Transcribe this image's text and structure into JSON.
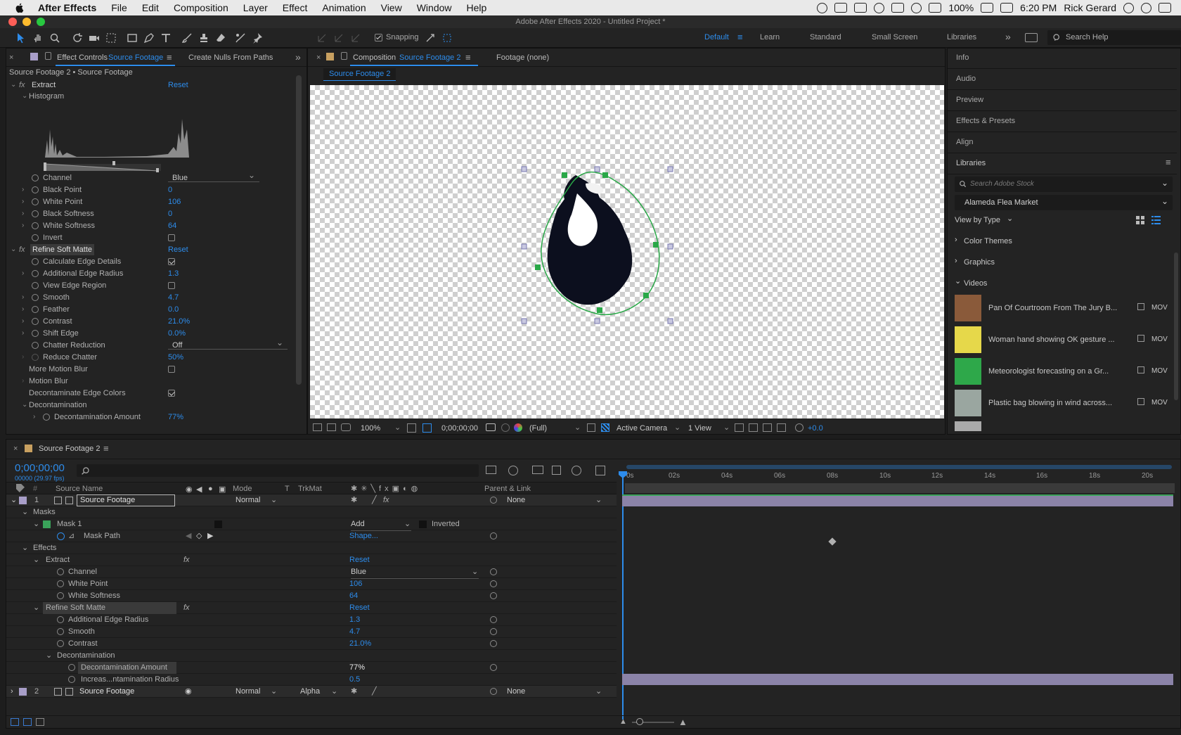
{
  "menubar": {
    "items": [
      "After Effects",
      "File",
      "Edit",
      "Composition",
      "Layer",
      "Effect",
      "Animation",
      "View",
      "Window",
      "Help"
    ],
    "battery": "100%",
    "time": "6:20 PM",
    "user": "Rick Gerard"
  },
  "titlebar": {
    "title": "Adobe After Effects 2020 - Untitled Project *"
  },
  "toolbar": {
    "snapping": "Snapping",
    "workspaces": [
      "Default",
      "Learn",
      "Standard",
      "Small Screen",
      "Libraries"
    ],
    "search_placeholder": "Search Help"
  },
  "effect_controls": {
    "tab_prefix": "Effect Controls",
    "tab_layer": "Source Footage",
    "tab2": "Create Nulls From Paths",
    "breadcrumb": "Source Footage 2 • Source Footage",
    "reset": "Reset",
    "extract": {
      "name": "Extract",
      "histogram": "Histogram",
      "channel": {
        "label": "Channel",
        "value": "Blue"
      },
      "black_point": {
        "label": "Black Point",
        "value": "0"
      },
      "white_point": {
        "label": "White Point",
        "value": "106"
      },
      "black_softness": {
        "label": "Black Softness",
        "value": "0"
      },
      "white_softness": {
        "label": "White Softness",
        "value": "64"
      },
      "invert": {
        "label": "Invert"
      }
    },
    "refine": {
      "name": "Refine Soft Matte",
      "calc_edge": {
        "label": "Calculate Edge Details"
      },
      "add_edge_radius": {
        "label": "Additional Edge Radius",
        "value": "1.3"
      },
      "view_edge": {
        "label": "View Edge Region"
      },
      "smooth": {
        "label": "Smooth",
        "value": "4.7"
      },
      "feather": {
        "label": "Feather",
        "value": "0.0"
      },
      "contrast": {
        "label": "Contrast",
        "value": "21.0%"
      },
      "shift_edge": {
        "label": "Shift Edge",
        "value": "0.0%"
      },
      "chatter": {
        "label": "Chatter Reduction",
        "value": "Off"
      },
      "reduce_chatter": {
        "label": "Reduce Chatter",
        "value": "50%"
      },
      "more_motion_blur": {
        "label": "More Motion Blur"
      },
      "motion_blur": {
        "label": "Motion Blur"
      },
      "decontam_colors": {
        "label": "Decontaminate Edge Colors"
      },
      "decontamination": {
        "label": "Decontamination"
      },
      "decontam_amount": {
        "label": "Decontamination Amount",
        "value": "77%"
      }
    }
  },
  "composition": {
    "tab_prefix": "Composition",
    "tab_comp": "Source Footage 2",
    "tab2": "Footage (none)",
    "flowchart_tab": "Source Footage 2",
    "zoom": "100%",
    "timecode": "0;00;00;00",
    "resolution": "(Full)",
    "camera": "Active Camera",
    "views": "1 View",
    "exposure": "+0.0"
  },
  "right_panel": {
    "items": [
      "Info",
      "Audio",
      "Preview",
      "Effects & Presets",
      "Align"
    ],
    "libraries": {
      "title": "Libraries",
      "search_placeholder": "Search Adobe Stock",
      "library": "Alameda Flea Market",
      "view_by": "View by Type",
      "groups": [
        "Color Themes",
        "Graphics",
        "Videos"
      ],
      "videos": [
        {
          "title": "Pan Of Courtroom From The Jury B...",
          "format": "MOV",
          "color": "#8a5a3a"
        },
        {
          "title": "Woman hand showing OK gesture ...",
          "format": "MOV",
          "color": "#e6d84a"
        },
        {
          "title": "Meteorologist forecasting on a Gr...",
          "format": "MOV",
          "color": "#2ea84a"
        },
        {
          "title": "Plastic bag blowing in wind across...",
          "format": "MOV",
          "color": "#9aa6a0"
        }
      ]
    }
  },
  "timeline": {
    "tab": "Source Footage 2",
    "timecode": "0;00;00;00",
    "fps": "00000 (29.97 fps)",
    "columns": {
      "source_name": "Source Name",
      "mode": "Mode",
      "t": "T",
      "trkmat": "TrkMat",
      "parent": "Parent & Link"
    },
    "ruler": [
      "0s",
      "02s",
      "04s",
      "06s",
      "08s",
      "10s",
      "12s",
      "14s",
      "16s",
      "18s",
      "20s"
    ],
    "layer1": {
      "num": "1",
      "name": "Source Footage",
      "mode": "Normal",
      "parent": "None"
    },
    "masks": "Masks",
    "mask1": {
      "name": "Mask 1",
      "mode": "Add",
      "inverted": "Inverted"
    },
    "mask_path": {
      "name": "Mask Path",
      "value": "Shape..."
    },
    "effects": "Effects",
    "extract": {
      "name": "Extract",
      "reset": "Reset"
    },
    "channel": {
      "name": "Channel",
      "value": "Blue"
    },
    "white_point": {
      "name": "White Point",
      "value": "106"
    },
    "white_softness": {
      "name": "White Softness",
      "value": "64"
    },
    "refine": {
      "name": "Refine Soft Matte",
      "reset": "Reset"
    },
    "add_edge_radius": {
      "name": "Additional Edge Radius",
      "value": "1.3"
    },
    "smooth": {
      "name": "Smooth",
      "value": "4.7"
    },
    "contrast": {
      "name": "Contrast",
      "value": "21.0%"
    },
    "decontamination": {
      "name": "Decontamination"
    },
    "decontam_amount": {
      "name": "Decontamination Amount",
      "value": "77%"
    },
    "increase_radius": {
      "name": "Increas...ntamination Radius",
      "value": "0.5"
    },
    "layer2": {
      "num": "2",
      "name": "Source Footage",
      "mode": "Normal",
      "trkmat": "Alpha",
      "parent": "None"
    }
  },
  "colors": {
    "accent": "#2d8ceb",
    "panel": "#232323",
    "label_green": "#3aa35a",
    "label_lavender": "#a89ec8"
  }
}
